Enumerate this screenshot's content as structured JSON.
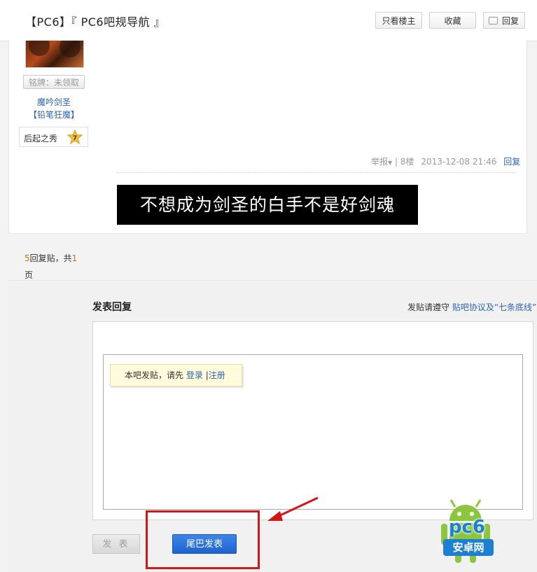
{
  "header": {
    "title": "【PC6】『 PC6吧规导航 』",
    "btn_only_op": "只看楼主",
    "btn_favorite": "收藏",
    "btn_reply": "回复"
  },
  "post": {
    "badge_label": "铭牌：未领取",
    "username": "魔吟剑圣",
    "user_group": "【铅笔狂魔】",
    "level_name": "后起之秀",
    "level_num": "7",
    "report": "举报",
    "floor": "8楼",
    "timestamp": "2013-12-08 21:46",
    "reply_link": "回复",
    "banner_text": "不想成为剑圣的白手不是好剑魂"
  },
  "pager": {
    "count": "5",
    "label_a": "回复贴，共",
    "pages": "1",
    "label_b": "页"
  },
  "reply": {
    "title": "发表回复",
    "notice_prefix": "发贴请遵守",
    "notice_link": "贴吧协议及“七条底线”",
    "tip_prefix": "本吧发贴，请先",
    "login": "登录",
    "sep": "|",
    "register": "注册",
    "btn_post": "发 表",
    "btn_tail": "尾巴发表"
  },
  "watermark": {
    "logo_text": "pc6",
    "logo_sub": "安卓网"
  },
  "colors": {
    "link": "#2d64b3",
    "accent_orange": "#e06b00",
    "primary_button": "#2a6fdb",
    "highlight_red": "#d01818"
  }
}
